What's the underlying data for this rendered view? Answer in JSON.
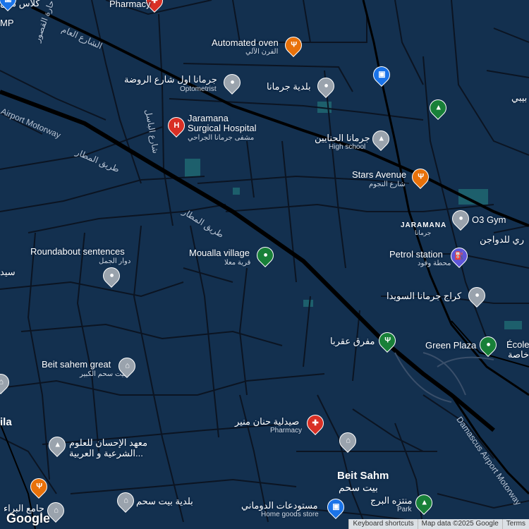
{
  "colors": {
    "background": "#13304f",
    "minor_road": "#0b1422",
    "major_road": "#000000",
    "park_block": "#1d5f6c"
  },
  "places": {
    "pharmacy_top": "Pharmacy",
    "automated_oven": "Automated oven",
    "automated_oven_ar": "الفرن الآلي",
    "germana_awal": "جرمانا اول شارع الروضة",
    "optometrist": "Optometrist",
    "baladiya_germana": "بلدية جرمانا",
    "jaramana_hospital_1": "Jaramana",
    "jaramana_hospital_2": "Surgical Hospital",
    "jaramana_hospital_ar": "مشفى جرمانا الجراحي",
    "germana_hanayen": "جرمانا الحنايين",
    "high_school": "High school",
    "stars_avenue": "Stars Avenue",
    "stars_avenue_ar": "شارع النجوم",
    "district": "JARAMANA",
    "district_ar": "جرمانا",
    "o3_gym": "O3 Gym",
    "poultry_partial": "ري للدواجن",
    "petrol_station": "Petrol station",
    "petrol_station_ar": "محطة وقود",
    "moualla_village": "Moualla village",
    "moualla_village_ar": "قرية معلا",
    "roundabout": "Roundabout sentences",
    "roundabout_ar": "دوار الجمل",
    "garage_sweida": "كراج جرمانا السويدا",
    "mafraq_aqraba": "مفرق عقربا",
    "green_plaza": "Green Plaza",
    "ecole": "École",
    "ecole_ar": "خاصة",
    "beit_sahem_great": "Beit sahem great",
    "beit_sahem_great_ar": "بيت سحم الكبير",
    "pharmacy_monir": "صيدلية حنان منير",
    "pharmacy_monir_en": "Pharmacy",
    "ihsan_institute_1": "معهد الإحسان للعلوم",
    "ihsan_institute_2": "الشرعية و العربية...",
    "beit_sahm": "Beit Sahm",
    "beit_sahm_ar": "بيت سحم",
    "montazah_burj": "منتزه البرج",
    "park": "Park",
    "mostawdaat": "مستودعات الدوماني",
    "home_goods": "Home goods store",
    "baladiya_beit_sahm": "بلدية بيت سحم",
    "jame_baraa": "جامع البراء",
    "left_partial_1": "سيد",
    "left_partial_2": "ila",
    "top_left_partial": "كلاس مول",
    "mp_partial": "MP",
    "right_partial": "بيبي"
  },
  "streets": {
    "airport_motorway": "Airport Motorway",
    "airport_road_ar_1": "طريق المطار",
    "airport_road_ar_2": "طريق المطار",
    "shari_aam": "الشارع العام",
    "qusur": "حارة القصور",
    "basel": "شارع الباسل",
    "damascus_airport": "Damascus Airport Motorway"
  },
  "icons": {
    "pharmacy": "pharmacy-cross-icon",
    "restaurant": "fork-knife-icon",
    "pin": "place-pin-icon",
    "hospital": "hospital-h-icon",
    "school": "graduation-cap-icon",
    "park": "tree-icon",
    "museum": "museum-columns-icon",
    "fuel": "fuel-pump-icon",
    "shopping": "shopping-bag-icon"
  },
  "footer": {
    "shortcuts": "Keyboard shortcuts",
    "mapdata": "Map data ©2025 Google",
    "terms": "Terms",
    "logo": "Google"
  }
}
